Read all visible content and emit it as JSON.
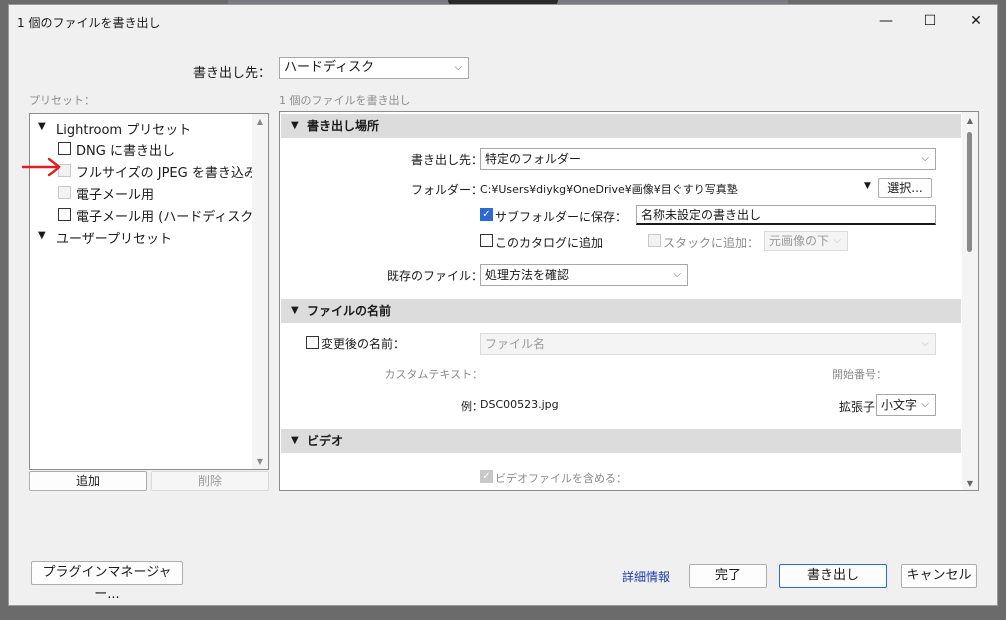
{
  "window": {
    "title": "1 個のファイルを書き出し",
    "minimize": "—",
    "maximize": "☐",
    "close": "✕"
  },
  "export_to": {
    "label": "書き出し先：",
    "value": "ハードディスク"
  },
  "left": {
    "presets_label": "プリセット：",
    "groups": [
      {
        "label": "Lightroom プリセット",
        "toggle": "▼"
      },
      {
        "label": "ユーザープリセット",
        "toggle": "▼"
      }
    ],
    "items": [
      {
        "label": "DNG に書き出し"
      },
      {
        "label": "フルサイズの JPEG を書き込み"
      },
      {
        "label": "電子メール用"
      },
      {
        "label": "電子メール用 (ハードディスク)"
      }
    ],
    "add_button": "追加",
    "delete_button": "削除"
  },
  "main": {
    "subtitle": "1 個のファイルを書き出し",
    "location": {
      "header": "書き出し場所",
      "export_to_label": "書き出し先：",
      "export_to_value": "特定のフォルダー",
      "folder_label": "フォルダー：",
      "folder_path": "C:¥Users¥diykg¥OneDrive¥画像¥目ぐすり写真塾",
      "choose_button": "選択...",
      "subfolder_label": "サブフォルダーに保存：",
      "subfolder_value": "名称未設定の書き出し",
      "add_catalog_label": "このカタログに追加",
      "stack_label": "スタックに追加：",
      "stack_value": "元画像の下",
      "existing_label": "既存のファイル：",
      "existing_value": "処理方法を確認"
    },
    "naming": {
      "header": "ファイルの名前",
      "rename_label": "変更後の名前：",
      "rename_value": "ファイル名",
      "custom_text_label": "カスタムテキスト：",
      "start_number_label": "開始番号：",
      "example_label": "例：",
      "example_value": "DSC00523.jpg",
      "extension_label": "拡張子：",
      "extension_value": "小文字"
    },
    "video": {
      "header": "ビデオ",
      "include_label": "ビデオファイルを含める："
    }
  },
  "footer": {
    "plugin_manager": "プラグインマネージャー...",
    "details_link": "詳細情報",
    "done": "完了",
    "export": "書き出し",
    "cancel": "キャンセル"
  },
  "icons": {
    "chevron": "⌵",
    "tri_down": "▼",
    "check": "✓",
    "scroll_up": "▲",
    "scroll_down": "▼"
  },
  "colors": {
    "accent": "#2a6ad1",
    "link": "#1a3ea8",
    "annotation": "#e02020"
  }
}
